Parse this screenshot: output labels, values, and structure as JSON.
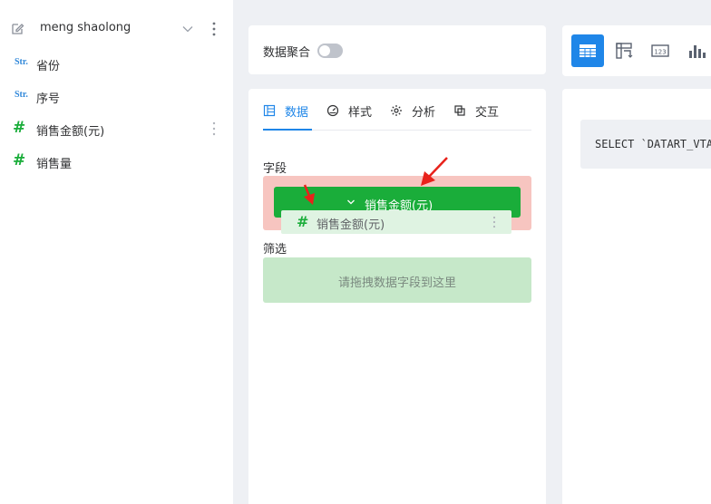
{
  "sidebar": {
    "datasource_name": "meng shaolong",
    "fields": [
      {
        "type_badge": "Str.",
        "label": "省份"
      },
      {
        "type_badge": "Str.",
        "label": "序号"
      },
      {
        "type_badge": "#",
        "label": "销售金额(元)"
      },
      {
        "type_badge": "#",
        "label": "销售量"
      }
    ]
  },
  "aggregation": {
    "label": "数据聚合",
    "enabled": false
  },
  "config_tabs": [
    {
      "label": "数据",
      "icon": "table-icon",
      "active": true
    },
    {
      "label": "样式",
      "icon": "gauge-icon",
      "active": false
    },
    {
      "label": "分析",
      "icon": "gear-icon",
      "active": false
    },
    {
      "label": "交互",
      "icon": "layers-icon",
      "active": false
    }
  ],
  "sections": {
    "fields_label": "字段",
    "filter_label": "筛选",
    "field_chip": "销售金额(元)",
    "dragging_item": "销售金额(元)",
    "filter_placeholder": "请拖拽数据字段到这里"
  },
  "toolbar": {
    "buttons": [
      {
        "icon": "table-icon",
        "active": true
      },
      {
        "icon": "pivot-table-icon",
        "active": false
      },
      {
        "icon": "number-card-icon",
        "active": false
      },
      {
        "icon": "bar-chart-icon",
        "active": false
      }
    ]
  },
  "sql_preview": "SELECT `DATART_VTABLE`",
  "colors": {
    "accent": "#1f86e8",
    "field_green": "#1aad3a",
    "drop_highlight": "#f7c5c0",
    "filter_zone": "#c6e8c9",
    "annotation_arrow": "#e8221b"
  }
}
